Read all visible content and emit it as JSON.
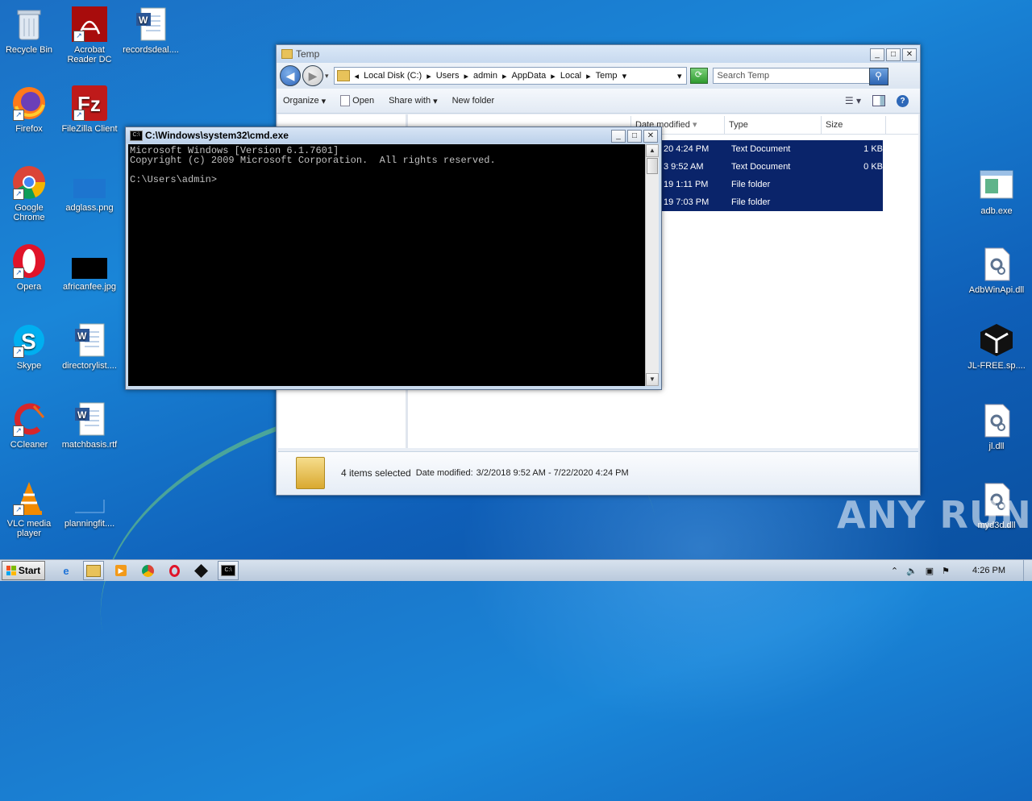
{
  "desktop": {
    "icons_left": [
      {
        "label": "Recycle Bin",
        "icon": "recycle-bin-icon"
      },
      {
        "label": "Acrobat Reader DC",
        "icon": "acrobat-icon"
      },
      {
        "label": "recordsdeal....",
        "icon": "word-doc-icon"
      },
      {
        "label": "Firefox",
        "icon": "firefox-icon"
      },
      {
        "label": "FileZilla Client",
        "icon": "filezilla-icon"
      },
      {
        "label": "Google Chrome",
        "icon": "chrome-icon"
      },
      {
        "label": "adglass.png",
        "icon": "image-file-icon"
      },
      {
        "label": "Opera",
        "icon": "opera-icon"
      },
      {
        "label": "africanfee.jpg",
        "icon": "image-file-icon"
      },
      {
        "label": "Skype",
        "icon": "skype-icon"
      },
      {
        "label": "directorylist....",
        "icon": "word-doc-icon"
      },
      {
        "label": "CCleaner",
        "icon": "ccleaner-icon"
      },
      {
        "label": "matchbasis.rtf",
        "icon": "word-doc-icon"
      },
      {
        "label": "VLC media player",
        "icon": "vlc-icon"
      },
      {
        "label": "planningfit....",
        "icon": "file-icon"
      }
    ],
    "icons_right": [
      {
        "label": "adb.exe",
        "icon": "exe-window-icon"
      },
      {
        "label": "AdbWinApi.dll",
        "icon": "dll-gear-icon"
      },
      {
        "label": "JL-FREE.sp....",
        "icon": "box-icon"
      },
      {
        "label": "jl.dll",
        "icon": "dll-gear-icon"
      },
      {
        "label": "myd3d.dll",
        "icon": "dll-gear-icon"
      }
    ],
    "watermark": "ANY RUN"
  },
  "explorer": {
    "title": "Temp",
    "breadcrumb": [
      "Local Disk (C:)",
      "Users",
      "admin",
      "AppData",
      "Local",
      "Temp"
    ],
    "search_placeholder": "Search Temp",
    "toolbar": {
      "organize": "Organize",
      "open": "Open",
      "share_with": "Share with",
      "new_folder": "New folder"
    },
    "columns": {
      "date_modified": "Date modified",
      "type": "Type",
      "size": "Size"
    },
    "rows": [
      {
        "date": "20 4:24 PM",
        "type": "Text Document",
        "size": "1 KB"
      },
      {
        "date": "3 9:52 AM",
        "type": "Text Document",
        "size": "0 KB"
      },
      {
        "date": "19 1:11 PM",
        "type": "File folder",
        "size": ""
      },
      {
        "date": "19 7:03 PM",
        "type": "File folder",
        "size": ""
      }
    ],
    "details": {
      "selected": "4 items selected",
      "date_label": "Date modified:",
      "date_range": "3/2/2018 9:52 AM - 7/22/2020 4:24 PM"
    }
  },
  "cmd": {
    "title": "C:\\Windows\\system32\\cmd.exe",
    "lines": [
      "Microsoft Windows [Version 6.1.7601]",
      "Copyright (c) 2009 Microsoft Corporation.  All rights reserved.",
      "",
      "C:\\Users\\admin>"
    ]
  },
  "taskbar": {
    "start_label": "Start",
    "clock": "4:26 PM"
  },
  "colors": {
    "selection": "#0a246a",
    "desktop": "#1a86d8"
  }
}
